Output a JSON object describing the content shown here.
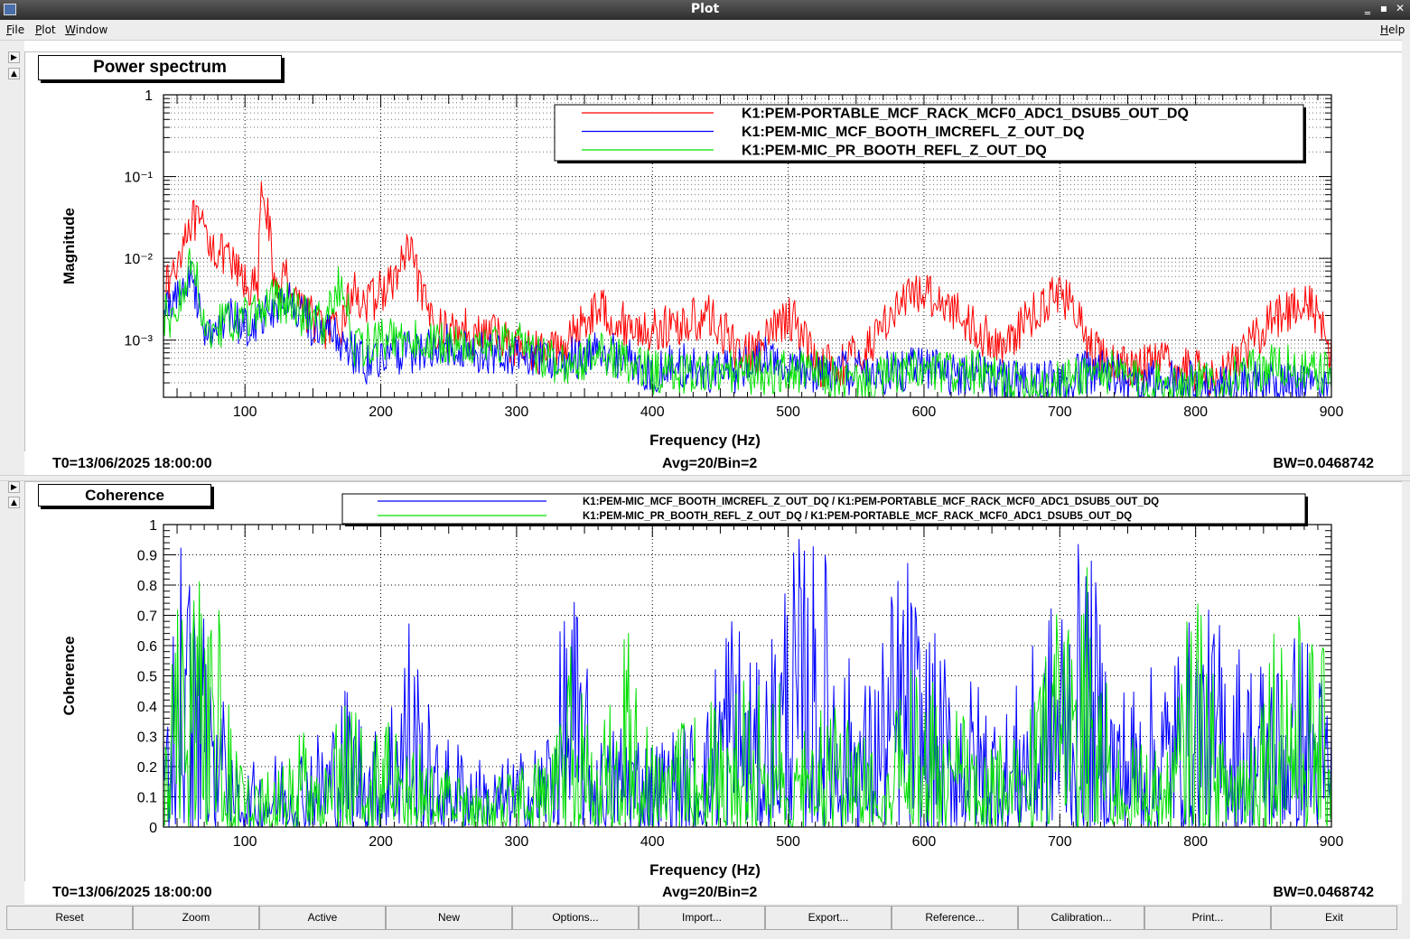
{
  "window": {
    "title": "Plot"
  },
  "menu": {
    "file": "File",
    "plot": "Plot",
    "window": "Window",
    "help": "Help"
  },
  "top_panel": {
    "panel_title": "Power spectrum",
    "status": {
      "t0": "T0=13/06/2025 18:00:00",
      "avg": "Avg=20/Bin=2",
      "bw": "BW=0.0468742"
    },
    "chart_data": {
      "type": "line",
      "ylabel": "Magnitude",
      "xlabel": "Frequency (Hz)",
      "xlim": [
        40,
        900
      ],
      "ylim": [
        0.0002,
        1
      ],
      "yscale": "log",
      "grid": true,
      "legend_position": "top-right",
      "x_ticks": [
        "100",
        "200",
        "300",
        "400",
        "500",
        "600",
        "700",
        "800",
        "900"
      ],
      "y_ticks": [
        "1",
        "10⁻¹",
        "10⁻²",
        "10⁻³"
      ],
      "series": [
        {
          "name": "K1:PEM-PORTABLE_MCF_RACK_MCF0_ADC1_DSUB5_OUT_DQ",
          "color": "#ff0000",
          "x": [
            40,
            50,
            60,
            70,
            80,
            90,
            100,
            110,
            113,
            120,
            130,
            140,
            150,
            160,
            170,
            180,
            190,
            200,
            210,
            220,
            230,
            240,
            250,
            260,
            270,
            280,
            290,
            300,
            320,
            340,
            360,
            380,
            400,
            420,
            440,
            460,
            480,
            500,
            520,
            540,
            560,
            580,
            600,
            620,
            640,
            660,
            680,
            700,
            720,
            740,
            760,
            780,
            800,
            820,
            840,
            860,
            880,
            900
          ],
          "y": [
            0.003,
            0.008,
            0.03,
            0.02,
            0.012,
            0.008,
            0.005,
            0.004,
            0.07,
            0.004,
            0.006,
            0.003,
            0.0018,
            0.0013,
            0.0012,
            0.004,
            0.0025,
            0.004,
            0.005,
            0.012,
            0.003,
            0.0015,
            0.0012,
            0.0015,
            0.0011,
            0.0012,
            0.0011,
            0.0008,
            0.0007,
            0.001,
            0.0025,
            0.0015,
            0.0013,
            0.0015,
            0.002,
            0.0008,
            0.0007,
            0.002,
            0.0005,
            0.0005,
            0.0008,
            0.0025,
            0.004,
            0.0025,
            0.0012,
            0.0008,
            0.002,
            0.004,
            0.0008,
            0.0005,
            0.0005,
            0.0005,
            0.0004,
            0.0004,
            0.0008,
            0.002,
            0.003,
            0.0006
          ]
        },
        {
          "name": "K1:PEM-MIC_MCF_BOOTH_IMCREFL_Z_OUT_DQ",
          "color": "#0000ff",
          "x": [
            40,
            50,
            60,
            70,
            80,
            90,
            100,
            110,
            120,
            130,
            140,
            150,
            160,
            170,
            180,
            190,
            200,
            220,
            240,
            260,
            280,
            300,
            320,
            340,
            360,
            380,
            400,
            420,
            440,
            460,
            480,
            500,
            520,
            540,
            560,
            580,
            600,
            620,
            640,
            660,
            680,
            700,
            720,
            740,
            760,
            780,
            800,
            820,
            840,
            860,
            880,
            900
          ],
          "y": [
            0.002,
            0.004,
            0.005,
            0.0015,
            0.0012,
            0.0018,
            0.0015,
            0.0018,
            0.0025,
            0.003,
            0.002,
            0.0015,
            0.0012,
            0.001,
            0.0007,
            0.0005,
            0.0006,
            0.0007,
            0.0009,
            0.0008,
            0.0007,
            0.0007,
            0.0006,
            0.0006,
            0.0007,
            0.0006,
            0.0004,
            0.0005,
            0.0004,
            0.0004,
            0.0006,
            0.0005,
            0.0004,
            0.0004,
            0.0004,
            0.0004,
            0.0005,
            0.0004,
            0.0004,
            0.0003,
            0.0003,
            0.0003,
            0.0004,
            0.0004,
            0.0003,
            0.0003,
            0.0003,
            0.0003,
            0.0003,
            0.0003,
            0.0003,
            0.0003
          ]
        },
        {
          "name": "K1:PEM-MIC_PR_BOOTH_REFL_Z_OUT_DQ",
          "color": "#00e000",
          "x": [
            40,
            50,
            60,
            70,
            80,
            90,
            100,
            110,
            120,
            130,
            140,
            150,
            160,
            170,
            180,
            190,
            200,
            220,
            240,
            260,
            280,
            300,
            320,
            340,
            360,
            380,
            400,
            420,
            440,
            460,
            480,
            500,
            520,
            540,
            560,
            580,
            600,
            620,
            640,
            660,
            680,
            700,
            720,
            740,
            760,
            780,
            800,
            820,
            840,
            860,
            880,
            900
          ],
          "y": [
            0.002,
            0.002,
            0.008,
            0.0015,
            0.0015,
            0.0015,
            0.0018,
            0.002,
            0.003,
            0.003,
            0.002,
            0.002,
            0.0015,
            0.005,
            0.0008,
            0.0009,
            0.001,
            0.001,
            0.0009,
            0.0009,
            0.0009,
            0.0009,
            0.0006,
            0.0005,
            0.0007,
            0.0005,
            0.0004,
            0.0004,
            0.0004,
            0.0004,
            0.0004,
            0.0004,
            0.0004,
            0.0003,
            0.0003,
            0.0004,
            0.0004,
            0.0004,
            0.0004,
            0.0003,
            0.0003,
            0.0003,
            0.0004,
            0.0004,
            0.0003,
            0.0003,
            0.0003,
            0.0003,
            0.0004,
            0.0005,
            0.0004,
            0.0004
          ]
        }
      ]
    }
  },
  "bottom_panel": {
    "panel_title": "Coherence",
    "status": {
      "t0": "T0=13/06/2025 18:00:00",
      "avg": "Avg=20/Bin=2",
      "bw": "BW=0.0468742"
    },
    "chart_data": {
      "type": "line",
      "ylabel": "Coherence",
      "xlabel": "Frequency (Hz)",
      "xlim": [
        40,
        900
      ],
      "ylim": [
        0,
        1
      ],
      "grid": true,
      "legend_position": "top",
      "x_ticks": [
        "100",
        "200",
        "300",
        "400",
        "500",
        "600",
        "700",
        "800",
        "900"
      ],
      "y_ticks": [
        "0",
        "0.1",
        "0.2",
        "0.3",
        "0.4",
        "0.5",
        "0.6",
        "0.7",
        "0.8",
        "0.9",
        "1"
      ],
      "series": [
        {
          "name": "K1:PEM-MIC_MCF_BOOTH_IMCREFL_Z_OUT_DQ / K1:PEM-PORTABLE_MCF_RACK_MCF0_ADC1_DSUB5_OUT_DQ",
          "color": "#0000ff",
          "x": [
            40,
            50,
            55,
            60,
            70,
            80,
            90,
            100,
            120,
            140,
            160,
            175,
            200,
            220,
            240,
            260,
            280,
            300,
            320,
            340,
            360,
            380,
            400,
            420,
            440,
            455,
            480,
            500,
            526,
            540,
            560,
            585,
            600,
            620,
            640,
            660,
            680,
            700,
            720,
            740,
            760,
            780,
            800,
            820,
            840,
            860,
            880,
            900
          ],
          "y": [
            0.3,
            0.95,
            0.97,
            0.85,
            0.7,
            0.5,
            0.3,
            0.2,
            0.25,
            0.3,
            0.35,
            0.5,
            0.3,
            0.78,
            0.3,
            0.3,
            0.2,
            0.25,
            0.3,
            0.88,
            0.3,
            0.4,
            0.3,
            0.35,
            0.4,
            0.85,
            0.5,
            0.97,
            0.97,
            0.6,
            0.5,
            0.98,
            0.7,
            0.55,
            0.5,
            0.4,
            0.6,
            0.85,
            0.98,
            0.5,
            0.5,
            0.6,
            0.75,
            0.7,
            0.6,
            0.6,
            0.7,
            0.45
          ]
        },
        {
          "name": "K1:PEM-MIC_PR_BOOTH_REFL_Z_OUT_DQ / K1:PEM-PORTABLE_MCF_RACK_MCF0_ADC1_DSUB5_OUT_DQ",
          "color": "#00e000",
          "x": [
            40,
            50,
            60,
            70,
            80,
            90,
            100,
            120,
            140,
            160,
            175,
            200,
            215,
            240,
            260,
            280,
            300,
            320,
            340,
            360,
            384,
            400,
            420,
            440,
            460,
            480,
            500,
            520,
            540,
            560,
            580,
            600,
            620,
            640,
            660,
            680,
            700,
            720,
            740,
            760,
            780,
            800,
            820,
            840,
            860,
            880,
            900
          ],
          "y": [
            0.2,
            0.9,
            0.97,
            0.9,
            0.8,
            0.4,
            0.2,
            0.2,
            0.35,
            0.2,
            0.5,
            0.3,
            0.45,
            0.2,
            0.2,
            0.15,
            0.2,
            0.25,
            0.6,
            0.25,
            0.78,
            0.3,
            0.35,
            0.4,
            0.5,
            0.5,
            0.5,
            0.4,
            0.4,
            0.3,
            0.5,
            0.55,
            0.4,
            0.35,
            0.3,
            0.4,
            0.75,
            0.95,
            0.3,
            0.3,
            0.25,
            0.9,
            0.3,
            0.4,
            0.8,
            0.7,
            0.55
          ]
        }
      ]
    }
  },
  "buttons": [
    "Reset",
    "Zoom",
    "Active",
    "New",
    "Options...",
    "Import...",
    "Export...",
    "Reference...",
    "Calibration...",
    "Print...",
    "Exit"
  ]
}
